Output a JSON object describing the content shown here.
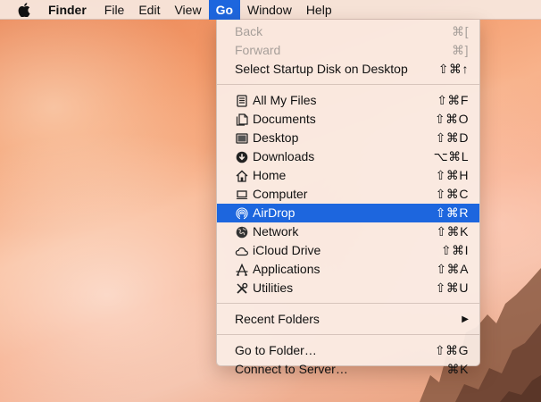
{
  "menubar": {
    "app_name": "Finder",
    "menus": [
      "File",
      "Edit",
      "View",
      "Go",
      "Window",
      "Help"
    ],
    "active_menu": "Go"
  },
  "go_menu": {
    "history": [
      {
        "label": "Back",
        "shortcut": "⌘[",
        "enabled": false
      },
      {
        "label": "Forward",
        "shortcut": "⌘]",
        "enabled": false
      },
      {
        "label": "Select Startup Disk on Desktop",
        "shortcut": "⇧⌘↑",
        "enabled": true
      }
    ],
    "places": [
      {
        "label": "All My Files",
        "shortcut": "⇧⌘F",
        "icon": "all-files-icon"
      },
      {
        "label": "Documents",
        "shortcut": "⇧⌘O",
        "icon": "documents-icon"
      },
      {
        "label": "Desktop",
        "shortcut": "⇧⌘D",
        "icon": "desktop-icon"
      },
      {
        "label": "Downloads",
        "shortcut": "⌥⌘L",
        "icon": "downloads-icon"
      },
      {
        "label": "Home",
        "shortcut": "⇧⌘H",
        "icon": "home-icon"
      },
      {
        "label": "Computer",
        "shortcut": "⇧⌘C",
        "icon": "computer-icon"
      },
      {
        "label": "AirDrop",
        "shortcut": "⇧⌘R",
        "icon": "airdrop-icon",
        "highlighted": true
      },
      {
        "label": "Network",
        "shortcut": "⇧⌘K",
        "icon": "network-icon"
      },
      {
        "label": "iCloud Drive",
        "shortcut": "⇧⌘I",
        "icon": "icloud-icon"
      },
      {
        "label": "Applications",
        "shortcut": "⇧⌘A",
        "icon": "applications-icon"
      },
      {
        "label": "Utilities",
        "shortcut": "⇧⌘U",
        "icon": "utilities-icon"
      }
    ],
    "recent": {
      "label": "Recent Folders",
      "submenu_indicator": "▶"
    },
    "goto": [
      {
        "label": "Go to Folder…",
        "shortcut": "⇧⌘G"
      },
      {
        "label": "Connect to Server…",
        "shortcut": "⌘K"
      }
    ]
  },
  "colors": {
    "highlight": "#1d66de",
    "disabled_text": "#a79f9a"
  }
}
